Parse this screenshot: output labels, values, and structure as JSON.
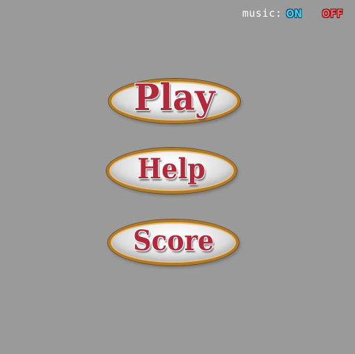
{
  "music": {
    "label": "music:",
    "on_label": "ON",
    "off_label": "OFF"
  },
  "menu": {
    "play_label": "Play",
    "help_label": "Help",
    "score_label": "Score"
  },
  "colors": {
    "background": "#9a9a9a",
    "button_text": "#b02a3c",
    "button_rim": "#b07a2a",
    "music_on": "#3ed2f2",
    "music_off": "#ff5f5f"
  }
}
